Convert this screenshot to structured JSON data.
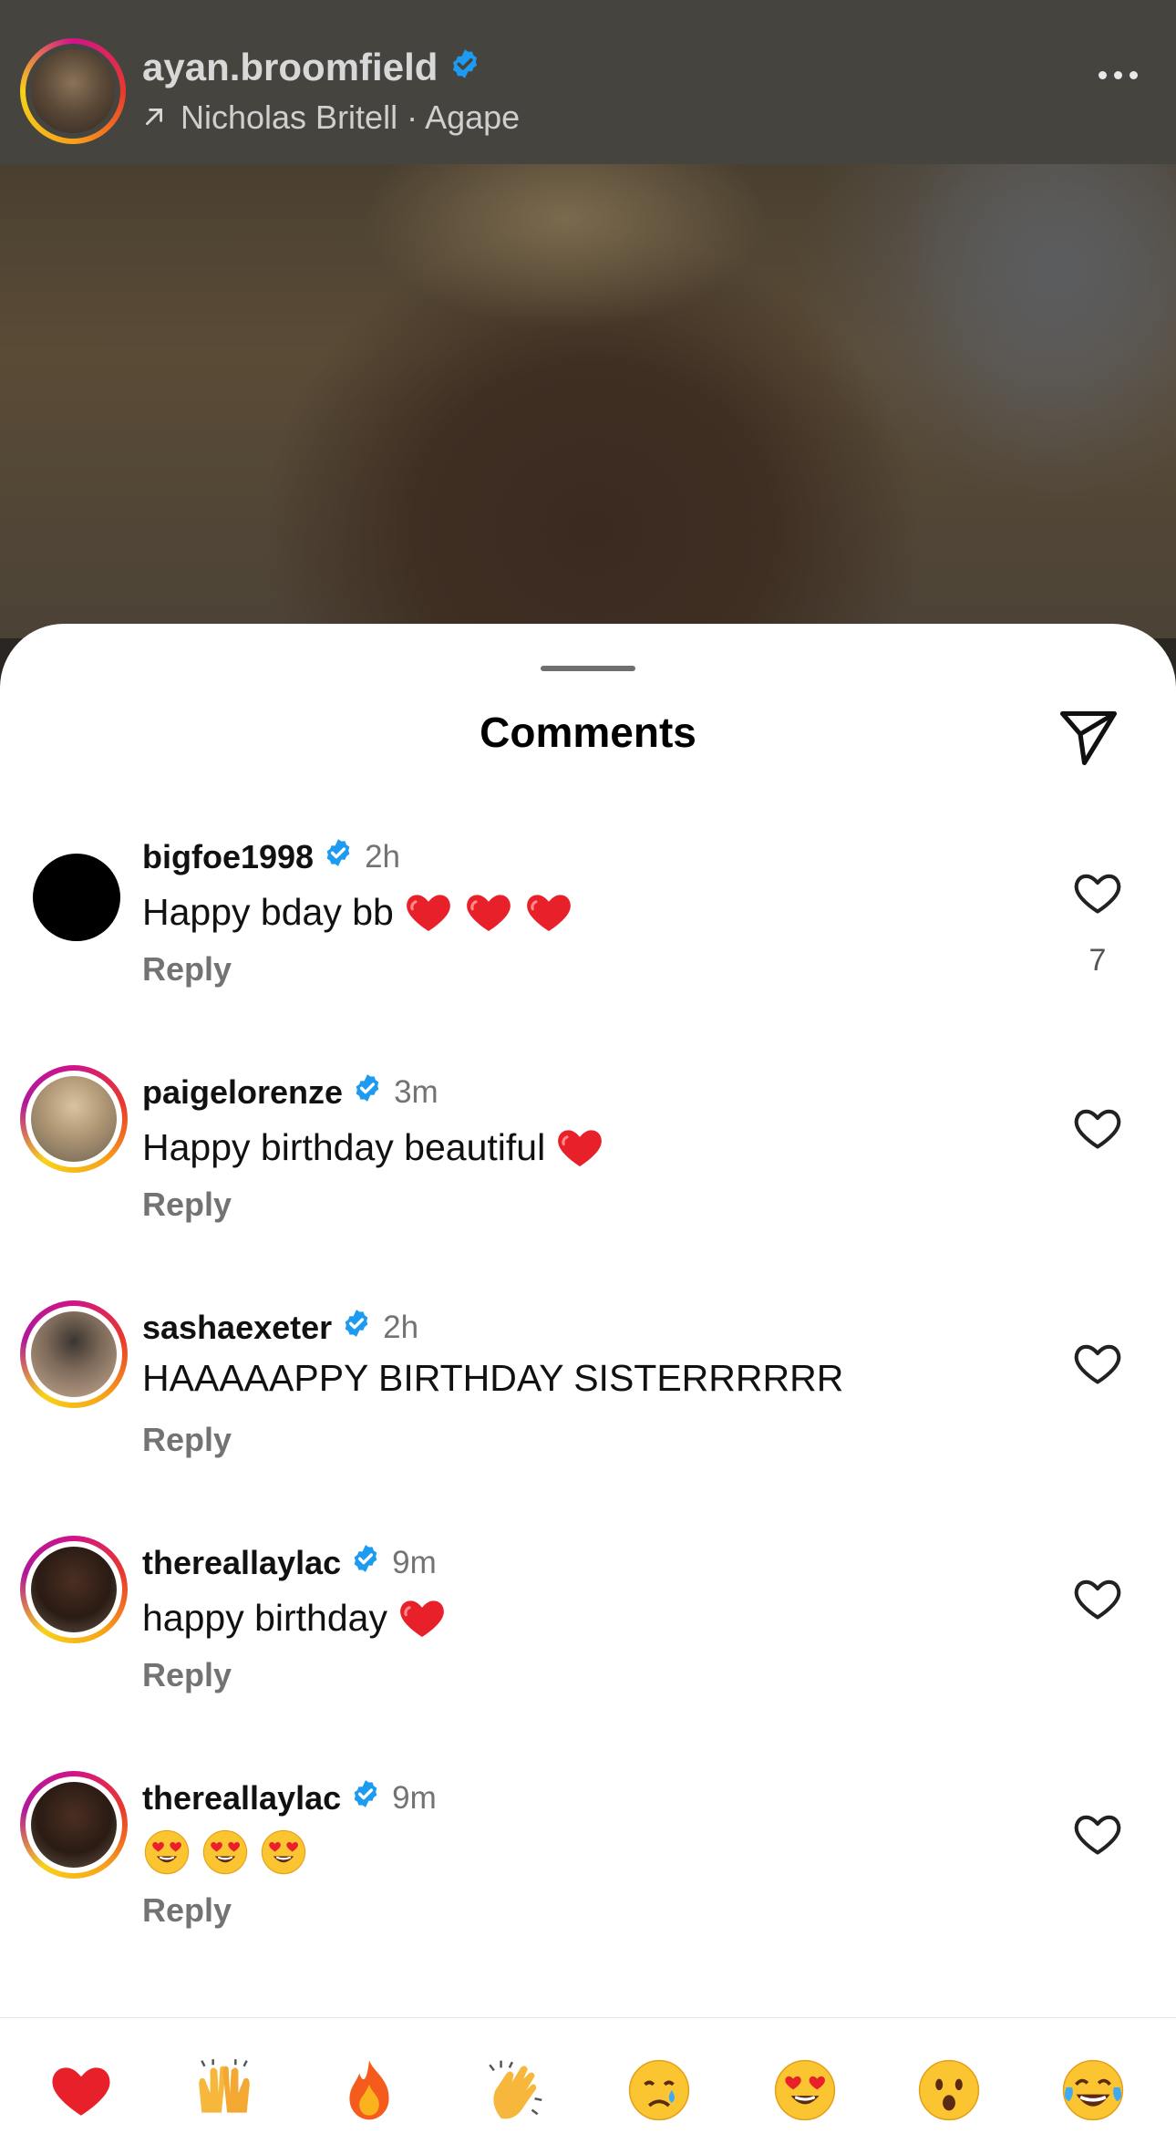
{
  "post": {
    "username": "ayan.broomfield",
    "music": "Nicholas Britell · Agape"
  },
  "sheet": {
    "title": "Comments"
  },
  "comments": [
    {
      "username": "bigfoe1998",
      "time": "2h",
      "text": "Happy bday bb",
      "emojis": [
        "red-heart-emoji",
        "red-heart-emoji",
        "red-heart-emoji"
      ],
      "reply_label": "Reply",
      "likes": "7"
    },
    {
      "username": "paigelorenze",
      "time": "3m",
      "text": "Happy birthday beautiful",
      "emojis": [
        "red-heart-emoji"
      ],
      "reply_label": "Reply"
    },
    {
      "username": "sashaexeter",
      "time": "2h",
      "text": "HAAAAAPPY BIRTHDAY SISTERRRRRR",
      "emojis": [],
      "reply_label": "Reply"
    },
    {
      "username": "thereallaylac",
      "time": "9m",
      "text": "happy birthday",
      "emojis": [
        "red-heart-emoji"
      ],
      "reply_label": "Reply"
    },
    {
      "username": "thereallaylac",
      "time": "9m",
      "text": "",
      "emojis": [
        "heart-eyes-emoji",
        "heart-eyes-emoji",
        "heart-eyes-emoji"
      ],
      "reply_label": "Reply"
    }
  ],
  "reactions": [
    "red-heart-emoji",
    "raising-hands-emoji",
    "fire-emoji",
    "clapping-hands-emoji",
    "crying-face-emoji",
    "heart-eyes-emoji",
    "surprised-face-emoji",
    "tears-of-joy-emoji"
  ],
  "colors": {
    "verified": "#1d9bf0",
    "heart": "#e8202a",
    "muted_text": "#737373"
  }
}
